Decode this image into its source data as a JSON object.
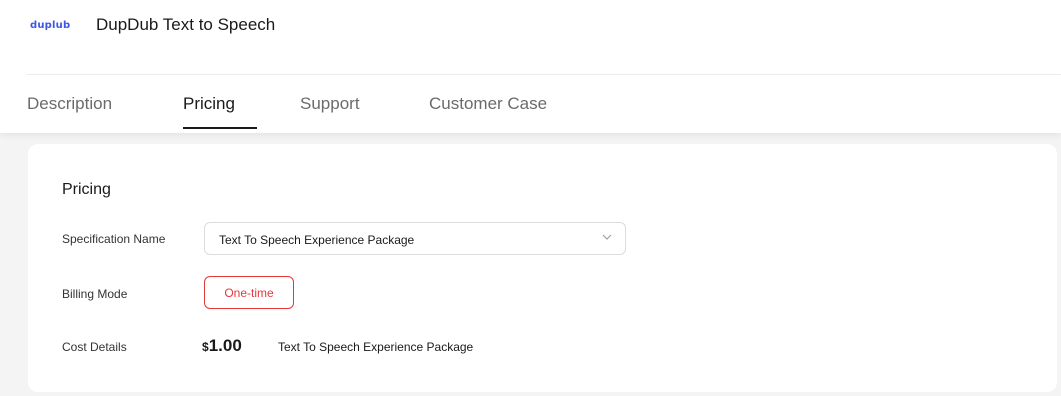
{
  "header": {
    "logo_text": "duplub",
    "title": "DupDub Text to Speech"
  },
  "tabs": [
    {
      "label": "Description",
      "active": false
    },
    {
      "label": "Pricing",
      "active": true
    },
    {
      "label": "Support",
      "active": false
    },
    {
      "label": "Customer Case",
      "active": false
    }
  ],
  "pricing": {
    "title": "Pricing",
    "spec_label": "Specification Name",
    "spec_value": "Text To Speech Experience Package",
    "billing_label": "Billing Mode",
    "billing_value": "One-time",
    "cost_label": "Cost Details",
    "cost_currency": "$",
    "cost_amount": "1.00",
    "cost_description": "Text To Speech Experience Package"
  },
  "colors": {
    "accent": "#e5383b",
    "logo": "#3b57e6",
    "page_bg": "#f4f4f5"
  },
  "icons": {
    "select_arrow": "chevron-down-icon"
  }
}
